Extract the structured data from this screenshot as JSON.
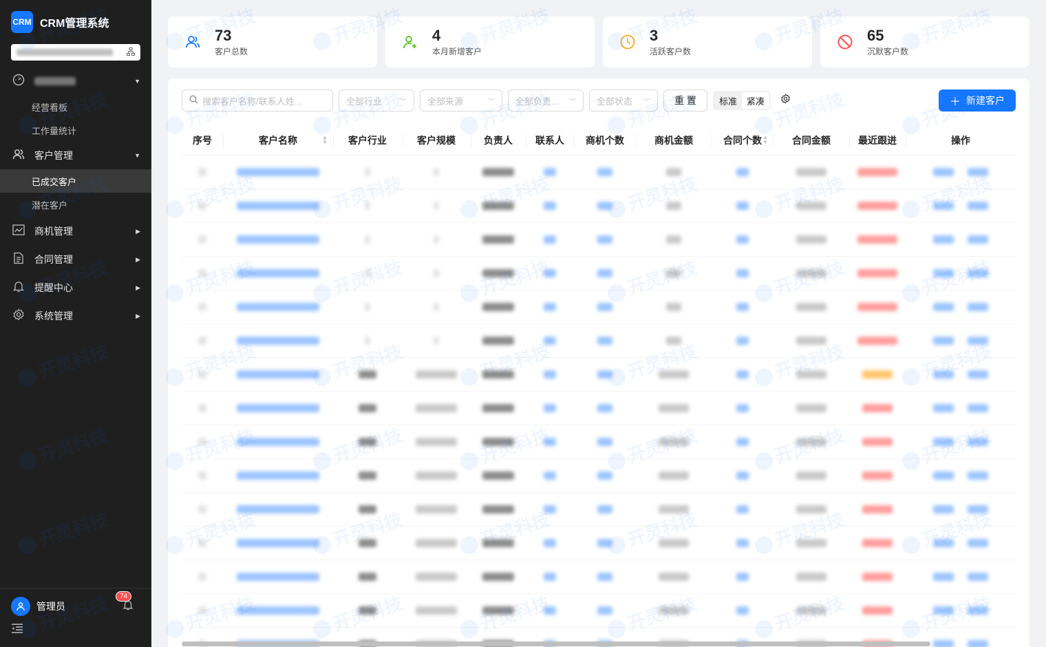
{
  "app": {
    "logo": "CRM",
    "title": "CRM管理系统"
  },
  "sidebar": {
    "menu": [
      {
        "label": "",
        "icon": "dashboard-icon",
        "expanded": true,
        "children": [
          "经营看板",
          "工作量统计"
        ]
      },
      {
        "label": "客户管理",
        "icon": "customer-icon",
        "expanded": true,
        "children": [
          "已成交客户",
          "潜在客户"
        ],
        "active_child": "已成交客户"
      },
      {
        "label": "商机管理",
        "icon": "chart-line-icon",
        "expanded": false
      },
      {
        "label": "合同管理",
        "icon": "document-icon",
        "expanded": false
      },
      {
        "label": "提醒中心",
        "icon": "bell-icon",
        "expanded": false
      },
      {
        "label": "系统管理",
        "icon": "gear-icon",
        "expanded": false
      }
    ],
    "user": {
      "name": "管理员",
      "notifications": "74"
    }
  },
  "stats": [
    {
      "value": "73",
      "label": "客户总数",
      "icon": "users-icon",
      "color": "#1677ff"
    },
    {
      "value": "4",
      "label": "本月新增客户",
      "icon": "user-add-icon",
      "color": "#52c41a"
    },
    {
      "value": "3",
      "label": "活跃客户数",
      "icon": "clock-icon",
      "color": "#faad14"
    },
    {
      "value": "65",
      "label": "沉默客户数",
      "icon": "stop-icon",
      "color": "#ff4d4f"
    }
  ],
  "toolbar": {
    "search_placeholder": "搜索客户名称/联系人姓...",
    "filters": [
      "全部行业",
      "全部来源",
      "全部负责...",
      "全部状态"
    ],
    "reset": "重 置",
    "density": [
      "标准",
      "紧凑"
    ],
    "density_selected": "紧凑",
    "create": "新建客户"
  },
  "table": {
    "columns": [
      "序号",
      "客户名称",
      "客户行业",
      "客户规模",
      "负责人",
      "联系人",
      "商机个数",
      "商机金额",
      "合同个数",
      "合同金额",
      "最近跟进",
      "操作"
    ],
    "sortable": [
      "客户名称",
      "合同个数"
    ]
  },
  "watermark": {
    "text": "开灵科技"
  }
}
